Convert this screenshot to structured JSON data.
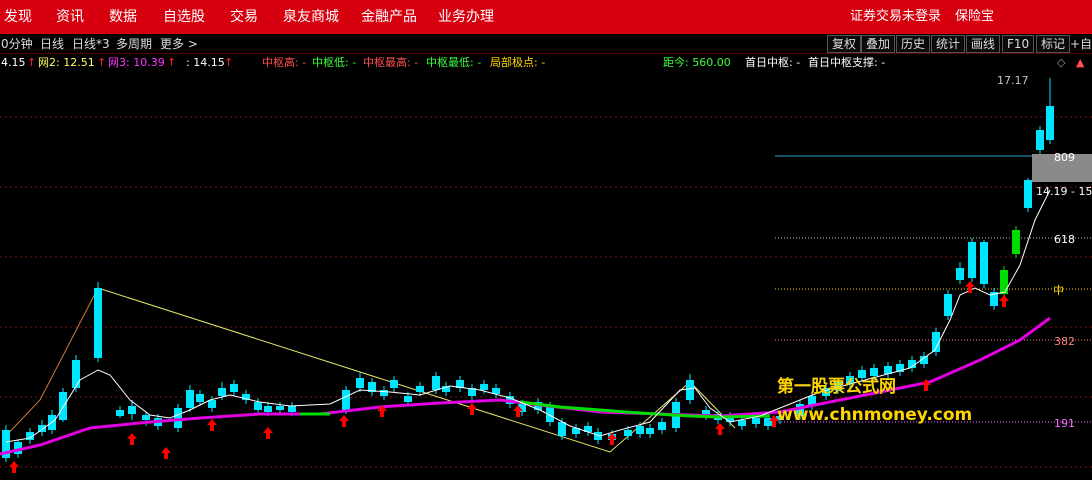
{
  "menu": {
    "items": [
      "发现",
      "资讯",
      "数据",
      "自选股",
      "交易",
      "泉友商城",
      "金融产品",
      "业务办理"
    ],
    "right": [
      "证券交易未登录",
      "保险宝"
    ]
  },
  "toolbar": {
    "left": [
      "0分钟",
      "日线",
      "日线*3",
      "多周期",
      "更多 >"
    ],
    "right": [
      "复权",
      "叠加",
      "历史",
      "统计",
      "画线",
      "F10",
      "标记",
      "+自"
    ]
  },
  "indicators": {
    "v1": "4.15",
    "wang2": "网2: 12.51",
    "wang3": "网3: 10.39",
    "v4": ": 14.15",
    "zs_high": "中枢高: -",
    "zs_low": "中枢低: -",
    "zs_max": "中枢最高: -",
    "zs_min": "中枢最低: -",
    "local_pole": "局部极点: -",
    "distance": "距今: 560.00",
    "first_day": "首日中枢: -",
    "first_day_support": "首日中枢支撑: -"
  },
  "axis_labels": {
    "top_value": "17.17",
    "fib_809": "809",
    "range": "14.19 - 15.",
    "fib_618": "618",
    "mid": "中",
    "fib_382": "382",
    "fib_191": "191"
  },
  "watermark": {
    "line1": "第一股票公式网",
    "line2": "www.chnmoney.com"
  },
  "colors": {
    "menubar": "#d6000f",
    "up": "#ffd400",
    "down": "#00e5ff",
    "ma_pink": "#e000e0",
    "ma_green": "#00dd00",
    "arrow": "#ff0000"
  }
}
